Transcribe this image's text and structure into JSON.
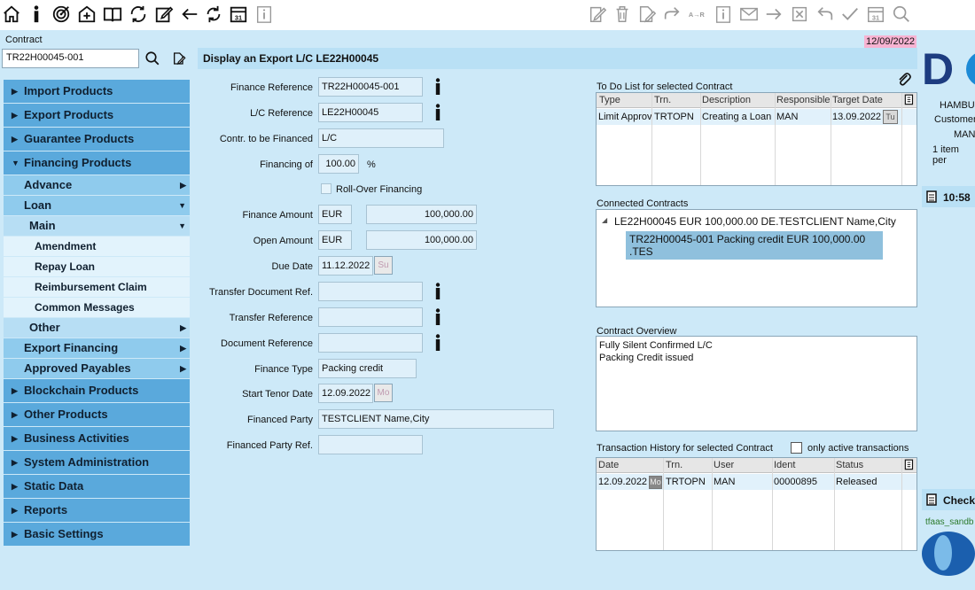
{
  "toolbar": {
    "left_icons": [
      "home-icon",
      "info-icon",
      "target-icon",
      "process-icon",
      "book-icon",
      "refresh-cycle-icon",
      "edit-icon",
      "back-arrow-icon",
      "reload-icon",
      "calendar-icon",
      "info-box-icon"
    ],
    "right_icons": [
      "edit-doc-icon",
      "trash-icon",
      "edit-page-icon",
      "forward-icon",
      "transfer-icon",
      "info-box-icon",
      "mail-icon",
      "right-arrow-icon",
      "close-box-icon",
      "undo-icon",
      "check-icon",
      "calendar-icon",
      "search-icon"
    ],
    "calendar_number": "31"
  },
  "contract": {
    "label": "Contract",
    "value": "TR22H00045-001"
  },
  "date_badge": "12/09/2022",
  "nav": {
    "items": [
      {
        "label": "Import Products"
      },
      {
        "label": "Export Products"
      },
      {
        "label": "Guarantee Products"
      },
      {
        "label": "Financing Products"
      },
      {
        "label": "Advance"
      },
      {
        "label": "Loan"
      },
      {
        "label": "Main"
      },
      {
        "label": "Amendment"
      },
      {
        "label": "Repay Loan"
      },
      {
        "label": "Reimbursement Claim"
      },
      {
        "label": "Common Messages"
      },
      {
        "label": "Other"
      },
      {
        "label": "Export Financing"
      },
      {
        "label": "Approved Payables"
      },
      {
        "label": "Blockchain Products"
      },
      {
        "label": "Other Products"
      },
      {
        "label": "Business Activities"
      },
      {
        "label": "System Administration"
      },
      {
        "label": "Static Data"
      },
      {
        "label": "Reports"
      },
      {
        "label": "Basic Settings"
      }
    ]
  },
  "title": "Display an Export L/C LE22H00045",
  "form": {
    "finance_reference": {
      "label": "Finance Reference",
      "value": "TR22H00045-001"
    },
    "lc_reference": {
      "label": "L/C Reference",
      "value": "LE22H00045"
    },
    "contr_financed": {
      "label": "Contr. to be Financed",
      "value": "L/C"
    },
    "financing_of": {
      "label": "Financing of",
      "value": "100.00",
      "unit": "%"
    },
    "rollover": {
      "label": "Roll-Over Financing"
    },
    "finance_amount": {
      "label": "Finance Amount",
      "currency": "EUR",
      "value": "100,000.00"
    },
    "open_amount": {
      "label": "Open Amount",
      "currency": "EUR",
      "value": "100,000.00"
    },
    "due_date": {
      "label": "Due Date",
      "value": "11.12.2022",
      "day": "Su"
    },
    "transfer_doc_ref": {
      "label": "Transfer Document Ref.",
      "value": ""
    },
    "transfer_ref": {
      "label": "Transfer Reference",
      "value": ""
    },
    "document_ref": {
      "label": "Document Reference",
      "value": ""
    },
    "finance_type": {
      "label": "Finance Type",
      "value": "Packing credit"
    },
    "start_tenor": {
      "label": "Start Tenor Date",
      "value": "12.09.2022",
      "day": "Mo"
    },
    "financed_party": {
      "label": "Financed Party",
      "value": "TESTCLIENT Name,City"
    },
    "financed_party_ref": {
      "label": "Financed Party Ref.",
      "value": ""
    }
  },
  "todo": {
    "title": "To Do List for selected Contract",
    "headers": [
      "Type",
      "Trn.",
      "Description",
      "Responsible",
      "Target Date"
    ],
    "rows": [
      {
        "type": "Limit Approv",
        "trn": "TRTOPN",
        "description": "Creating a Loan",
        "responsible": "MAN",
        "target_date": "13.09.2022",
        "day": "Tu"
      }
    ]
  },
  "connected": {
    "title": "Connected Contracts",
    "parent": "LE22H00045 EUR 100,000.00 DE.TESTCLIENT Name,City",
    "child": "TR22H00045-001 Packing credit EUR 100,000.00 .TES"
  },
  "overview": {
    "title": "Contract Overview",
    "lines": [
      "Fully Silent Confirmed L/C",
      "Packing Credit issued"
    ]
  },
  "history": {
    "title": "Transaction History for selected Contract",
    "only_active_label": "only active transactions",
    "headers": [
      "Date",
      "Trn.",
      "User",
      "Ident",
      "Status"
    ],
    "rows": [
      {
        "date": "12.09.2022",
        "day": "Mo",
        "trn": "TRTOPN",
        "user": "MAN",
        "ident": "00000895",
        "status": "Released"
      }
    ]
  },
  "right_strip": {
    "logo_text": "D",
    "line1": "HAMBU",
    "line2": "Customer",
    "line3": "MAN",
    "line4": "1 item per",
    "time": "10:58",
    "check": "Check",
    "sandbox": "tfaas_sandb"
  }
}
